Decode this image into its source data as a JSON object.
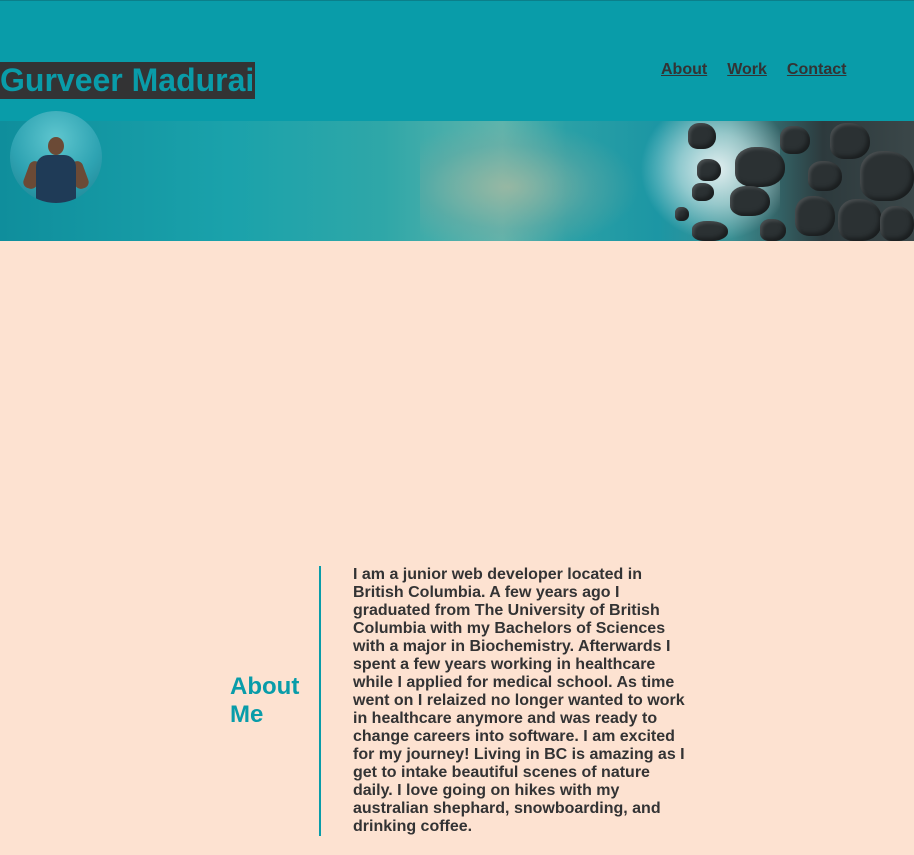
{
  "header": {
    "site_title": "Gurveer Madurai",
    "nav": {
      "about": "About",
      "work": "Work",
      "contact": "Contact"
    }
  },
  "about": {
    "heading": "About Me",
    "body": "I am a junior web developer located in British Columbia. A few years ago I graduated from The University of British Columbia with my Bachelors of Sciences with a major in Biochemistry. Afterwards I spent a few years working in healthcare while I applied for medical school. As time went on I relaized no longer wanted to work in healthcare anymore and was ready to change careers into software. I am excited for my journey! Living in BC is amazing as I get to intake beautiful scenes of nature daily. I love going on hikes with my australian shephard, snowboarding, and drinking coffee."
  },
  "colors": {
    "header_bg": "#099ca9",
    "accent": "#099ca9",
    "title_bg": "#333334",
    "text": "#333334",
    "page_bg": "#fde2d1"
  }
}
